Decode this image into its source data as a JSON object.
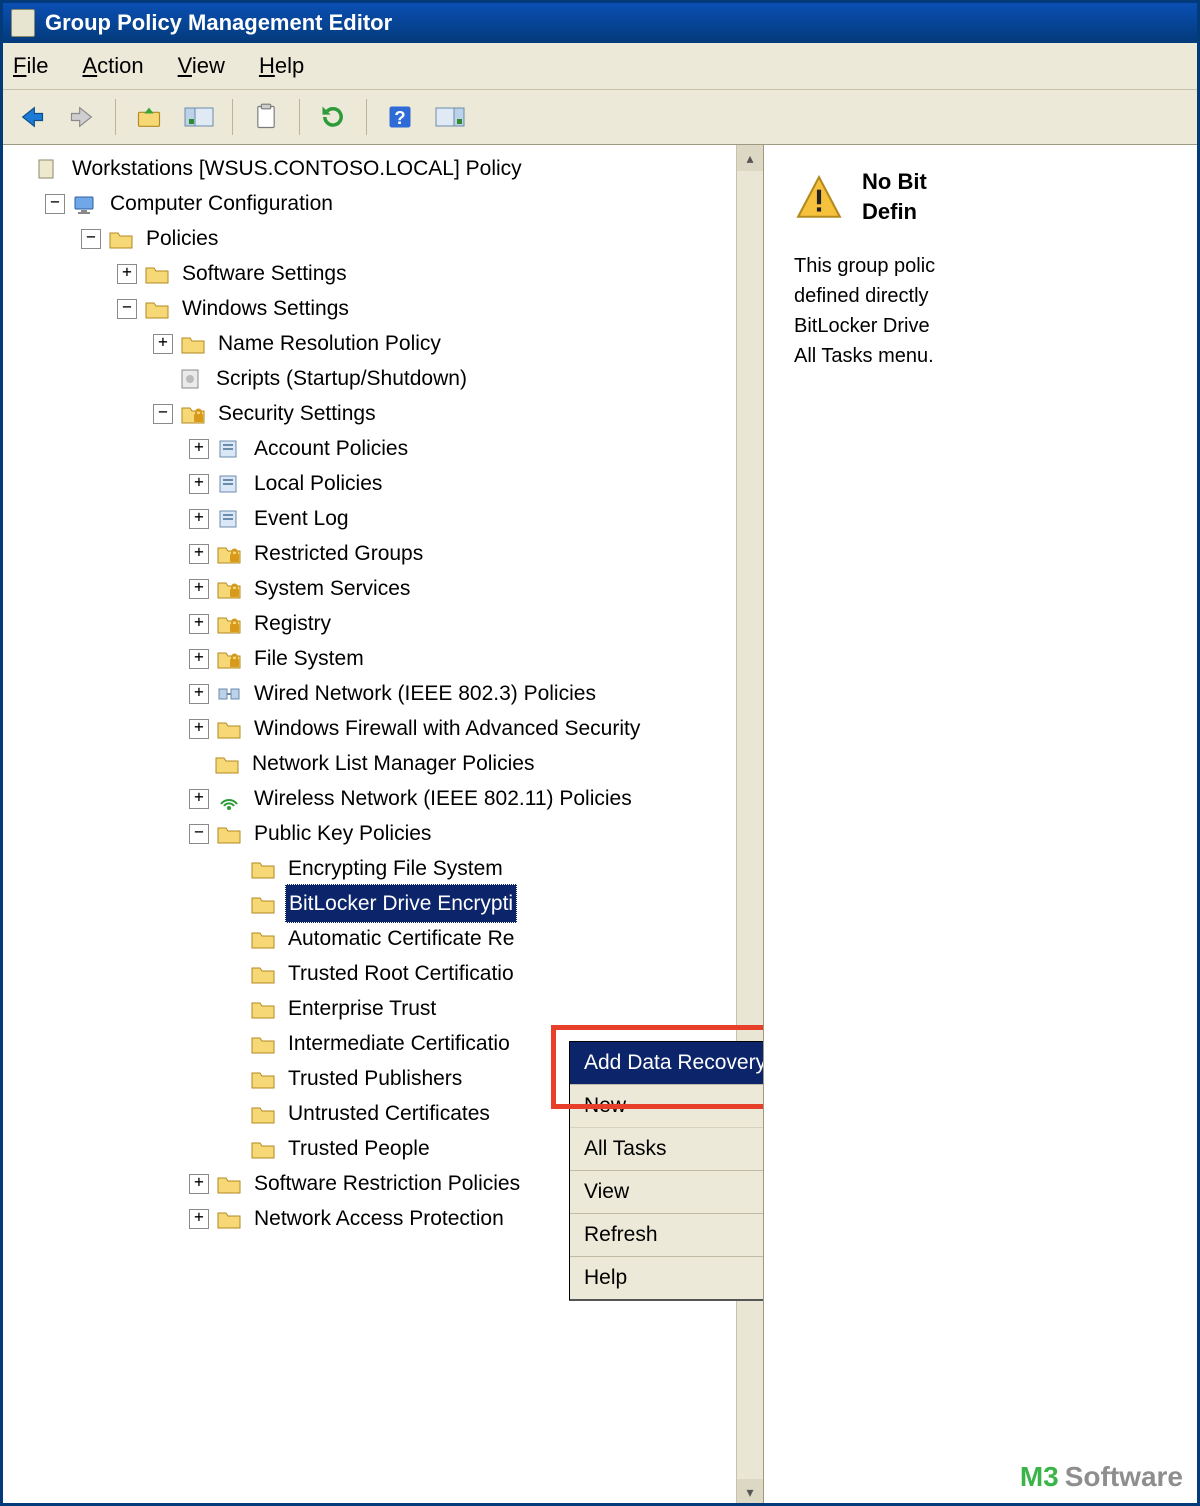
{
  "title": "Group Policy Management Editor",
  "menus": {
    "file": "File",
    "action": "Action",
    "view": "View",
    "help": "Help"
  },
  "toolbar_icons": [
    "back",
    "forward",
    "up-folder",
    "show-hide",
    "properties",
    "refresh",
    "help",
    "details-pane"
  ],
  "tree": {
    "root": {
      "label": "Workstations [WSUS.CONTOSO.LOCAL] Policy",
      "expander": "",
      "icon": "doc",
      "indent": 0
    },
    "cc": {
      "label": "Computer Configuration",
      "expander": "−",
      "icon": "computer",
      "indent": 1
    },
    "pol": {
      "label": "Policies",
      "expander": "−",
      "icon": "folder",
      "indent": 2
    },
    "ss": {
      "label": "Software Settings",
      "expander": "+",
      "icon": "folder",
      "indent": 3
    },
    "ws": {
      "label": "Windows Settings",
      "expander": "−",
      "icon": "folder",
      "indent": 3
    },
    "nrp": {
      "label": "Name Resolution Policy",
      "expander": "+",
      "icon": "folder",
      "indent": 4
    },
    "scr": {
      "label": "Scripts (Startup/Shutdown)",
      "expander": "",
      "icon": "script",
      "indent": 4
    },
    "sec": {
      "label": "Security Settings",
      "expander": "−",
      "icon": "folder-lock",
      "indent": 4
    },
    "acc": {
      "label": "Account Policies",
      "expander": "+",
      "icon": "policy",
      "indent": 5
    },
    "loc": {
      "label": "Local Policies",
      "expander": "+",
      "icon": "policy",
      "indent": 5
    },
    "evl": {
      "label": "Event Log",
      "expander": "+",
      "icon": "policy",
      "indent": 5
    },
    "rg": {
      "label": "Restricted Groups",
      "expander": "+",
      "icon": "folder-lock",
      "indent": 5
    },
    "ssv": {
      "label": "System Services",
      "expander": "+",
      "icon": "folder-lock",
      "indent": 5
    },
    "reg": {
      "label": "Registry",
      "expander": "+",
      "icon": "folder-lock",
      "indent": 5
    },
    "fs": {
      "label": "File System",
      "expander": "+",
      "icon": "folder-lock",
      "indent": 5
    },
    "wn3": {
      "label": "Wired Network (IEEE 802.3) Policies",
      "expander": "+",
      "icon": "net-wired",
      "indent": 5
    },
    "fw": {
      "label": "Windows Firewall with Advanced Security",
      "expander": "+",
      "icon": "folder",
      "indent": 5
    },
    "nlm": {
      "label": "Network List Manager Policies",
      "expander": "",
      "icon": "folder",
      "indent": 5
    },
    "wn11": {
      "label": "Wireless Network (IEEE 802.11) Policies",
      "expander": "+",
      "icon": "net-wifi",
      "indent": 5
    },
    "pkp": {
      "label": "Public Key Policies",
      "expander": "−",
      "icon": "folder",
      "indent": 5
    },
    "efs": {
      "label": "Encrypting File System",
      "expander": "",
      "icon": "folder",
      "indent": 6
    },
    "bde": {
      "label": "BitLocker Drive Encrypti",
      "expander": "",
      "icon": "folder",
      "indent": 6,
      "selected": true
    },
    "acr": {
      "label": "Automatic Certificate Re",
      "expander": "",
      "icon": "folder",
      "indent": 6
    },
    "trc": {
      "label": "Trusted Root Certificatio",
      "expander": "",
      "icon": "folder",
      "indent": 6
    },
    "ent": {
      "label": "Enterprise Trust",
      "expander": "",
      "icon": "folder",
      "indent": 6
    },
    "ica": {
      "label": "Intermediate Certificatio",
      "expander": "",
      "icon": "folder",
      "indent": 6
    },
    "tp": {
      "label": "Trusted Publishers",
      "expander": "",
      "icon": "folder",
      "indent": 6
    },
    "uc": {
      "label": "Untrusted Certificates",
      "expander": "",
      "icon": "folder",
      "indent": 6
    },
    "tpe": {
      "label": "Trusted People",
      "expander": "",
      "icon": "folder",
      "indent": 6
    },
    "srp": {
      "label": "Software Restriction Policies",
      "expander": "+",
      "icon": "folder",
      "indent": 5
    },
    "nap": {
      "label": "Network Access Protection",
      "expander": "+",
      "icon": "folder",
      "indent": 5
    }
  },
  "tree_order": [
    "root",
    "cc",
    "pol",
    "ss",
    "ws",
    "nrp",
    "scr",
    "sec",
    "acc",
    "loc",
    "evl",
    "rg",
    "ssv",
    "reg",
    "fs",
    "wn3",
    "fw",
    "nlm",
    "wn11",
    "pkp",
    "efs",
    "bde",
    "acr",
    "trc",
    "ent",
    "ica",
    "tp",
    "uc",
    "tpe",
    "srp",
    "nap"
  ],
  "context_menu": {
    "add_dra": "Add Data Recovery Agent...",
    "new": "New",
    "all_tasks": "All Tasks",
    "view": "View",
    "refresh": "Refresh",
    "help": "Help"
  },
  "right_pane": {
    "heading_l1": "No Bit",
    "heading_l2": "Defin",
    "body_l1": "This group polic",
    "body_l2": "defined directly",
    "body_l3": "BitLocker Drive",
    "body_l4": "All Tasks menu."
  },
  "watermark": {
    "m3": "M3",
    "software": "Software"
  }
}
